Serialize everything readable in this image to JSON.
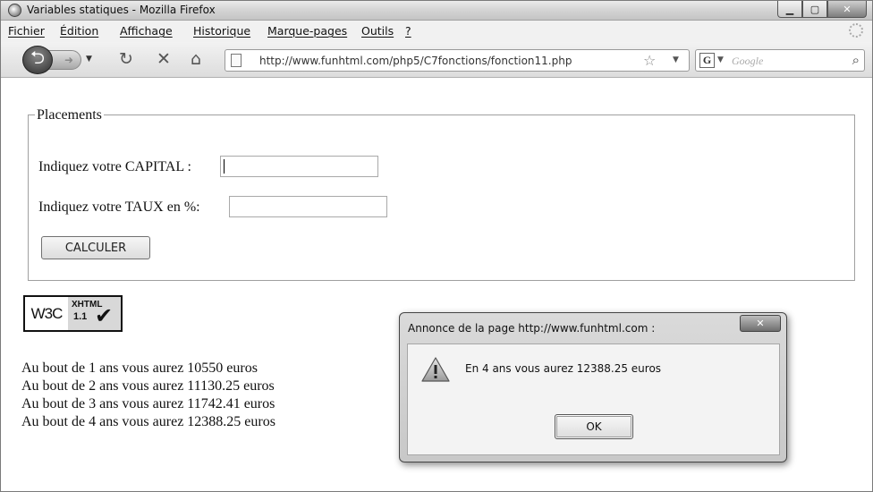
{
  "window": {
    "title": "Variables statiques - Mozilla Firefox",
    "controls": {
      "minimize": "▁",
      "maximize": "▢",
      "close": "✕"
    }
  },
  "menu": {
    "items": [
      "Fichier",
      "Édition",
      "Affichage",
      "Historique",
      "Marque-pages",
      "Outils",
      "?"
    ]
  },
  "navbar": {
    "url": "http://www.funhtml.com/php5/C7fonctions/fonction11.php",
    "search_engine_letter": "G",
    "search_placeholder": "Google",
    "icons": [
      "back-icon",
      "forward-icon",
      "reload-icon",
      "stop-icon",
      "home-icon",
      "page-icon",
      "bookmark-star-icon",
      "search-icon"
    ]
  },
  "form": {
    "legend": "Placements",
    "capital_label": "Indiquez votre CAPITAL :",
    "capital_value": "",
    "taux_label": "Indiquez votre TAUX en %:",
    "taux_value": "",
    "submit_label": "CALCULER"
  },
  "badge": {
    "w3c": "W3C",
    "xhtml": "XHTML",
    "version": "1.1"
  },
  "results": [
    "Au bout de 1 ans vous aurez 10550 euros",
    "Au bout de 2 ans vous aurez 11130.25 euros",
    "Au bout de 3 ans vous aurez 11742.41 euros",
    "Au bout de 4 ans vous aurez 12388.25 euros"
  ],
  "dialog": {
    "title": "Annonce de la page  http://www.funhtml.com :",
    "close_label": "✕",
    "message": "En 4 ans vous aurez 12388.25 euros",
    "ok_label": "OK",
    "icon": "warning-icon"
  }
}
